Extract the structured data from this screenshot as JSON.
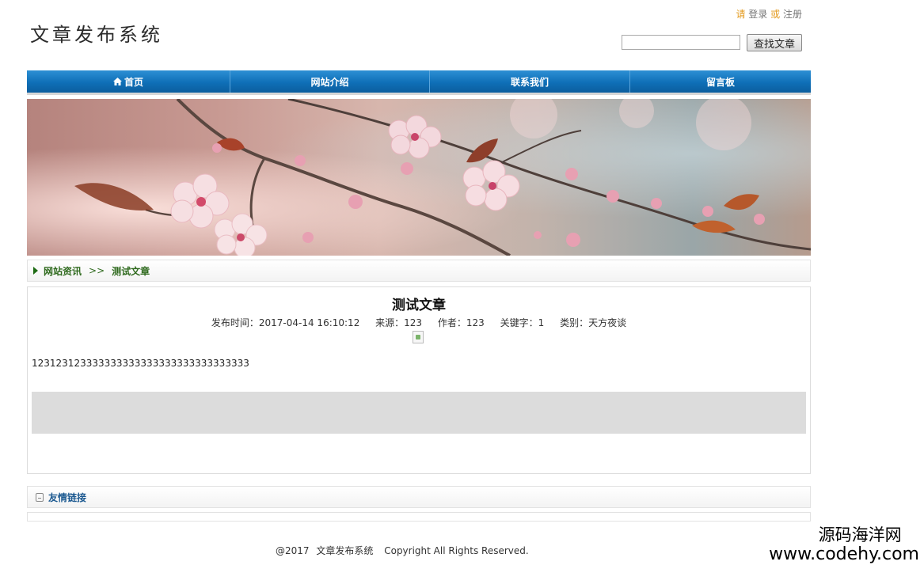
{
  "header": {
    "logo": "文章发布系统",
    "login": {
      "prefix": "请",
      "login_label": "登录",
      "or": "或",
      "register_label": "注册"
    },
    "search": {
      "value": "",
      "placeholder": "",
      "button_label": "查找文章"
    }
  },
  "nav": {
    "items": [
      {
        "label": "首页"
      },
      {
        "label": "网站介绍"
      },
      {
        "label": "联系我们"
      },
      {
        "label": "留言板"
      }
    ]
  },
  "breadcrumb": {
    "items": [
      "网站资讯",
      "测试文章"
    ],
    "separator": ">>"
  },
  "article": {
    "title": "测试文章",
    "meta": {
      "time": "发布时间：2017-04-14 16:10:12",
      "source": "来源：123",
      "author": "作者：123",
      "keywords": "关键字：1",
      "category": "类别：天方夜谈"
    },
    "body": "123123123333333333333333333333333333"
  },
  "links": {
    "title": "友情链接"
  },
  "footer": {
    "copyright_prefix": "@2017",
    "site": "文章发布系统",
    "rights": "Copyright All Rights Reserved."
  },
  "watermark": {
    "cn": "源码海洋网",
    "en": "www.codehy.com"
  },
  "colors": {
    "nav": "#0f6fb7",
    "breadcrumb_text": "#2f6a1e",
    "links_text": "#1d5a91",
    "login_accent": "#e39a1e"
  },
  "icons": {
    "home": "home-icon",
    "breadcrumb": "triangle-right-icon",
    "links": "book-icon"
  }
}
